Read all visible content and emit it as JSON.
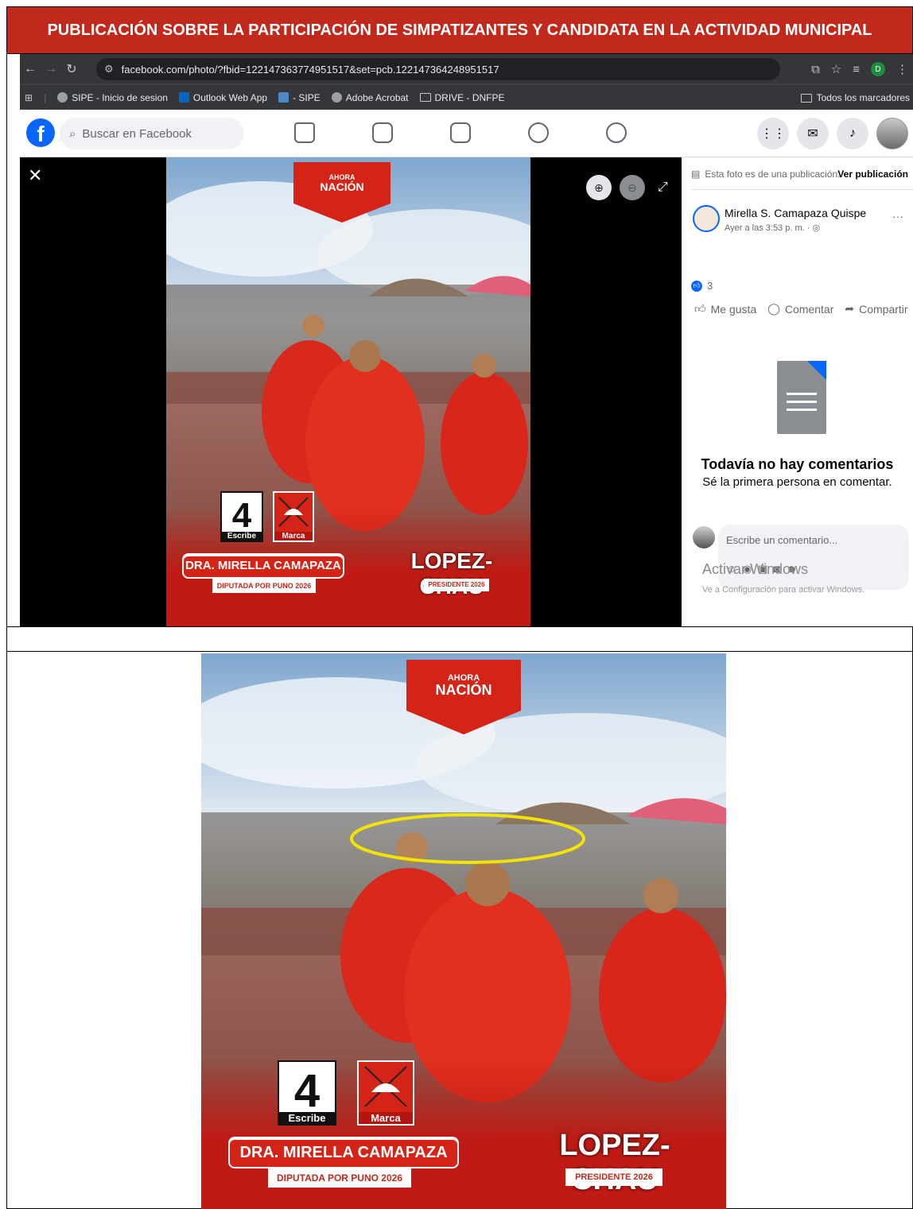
{
  "header": {
    "title": "PUBLICACIÓN SOBRE LA PARTICIPACIÓN DE SIMPATIZANTES Y CANDIDATA EN LA ACTIVIDAD MUNICIPAL"
  },
  "browser": {
    "url": "facebook.com/photo/?fbid=122147363774951517&set=pcb.122147364248951517",
    "profile_letter": "D",
    "bookmarks": [
      "SIPE - Inicio de sesion",
      "Outlook Web App",
      "- SIPE",
      "Adobe Acrobat",
      "DRIVE - DNFPE"
    ],
    "bookmarks_right": "Todos los marcadores"
  },
  "facebook": {
    "search_placeholder": "Buscar en Facebook",
    "photo_note": "Esta foto es de una publicación.",
    "view_post": "Ver publicación",
    "author": "Mirella S. Camapaza Quispe",
    "time": "Ayer a las 3:53 p. m. · ",
    "reaction_count": "3",
    "like": "Me gusta",
    "comment": "Comentar",
    "share": "Compartir",
    "no_comments_title": "Todavía no hay comentarios",
    "no_comments_sub": "Sé la primera persona en comentar.",
    "comment_placeholder": "Escribe un comentario...",
    "activate_windows": "Activar Windows",
    "activate_windows_sub": "Ve a Configuración para activar Windows."
  },
  "poster": {
    "brand_top": "AHORA",
    "brand_bottom": "NACIÓN",
    "number": "4",
    "number_label": "Escribe",
    "mark_label": "Marca",
    "candidate": "DRA. MIRELLA CAMAPAZA",
    "candidate_role": "DIPUTADA POR PUNO 2026",
    "president": "LOPEZ-CHAU",
    "president_role": "PRESIDENTE 2026"
  },
  "colors": {
    "brand_red": "#d42317",
    "header_red": "#c0291c",
    "highlight": "#f2e300",
    "facebook_blue": "#0866ff"
  }
}
